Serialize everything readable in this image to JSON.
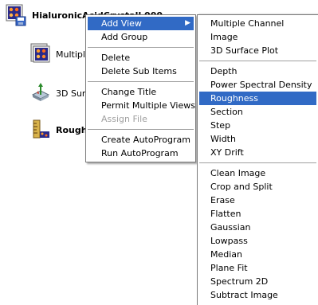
{
  "tree": {
    "root_label": "HialuronicAcidCrystall 000",
    "children": [
      {
        "label": "Multiple"
      },
      {
        "label": "3D Sur"
      },
      {
        "label": "Rough"
      }
    ]
  },
  "context_menu": {
    "items": [
      {
        "label": "Add View",
        "highlighted": true,
        "has_submenu": true
      },
      {
        "label": "Add Group"
      },
      {
        "label": "Delete"
      },
      {
        "label": "Delete Sub Items"
      },
      {
        "label": "Change Title"
      },
      {
        "label": "Permit Multiple Views"
      },
      {
        "label": "Assign File",
        "disabled": true
      },
      {
        "label": "Create AutoProgram"
      },
      {
        "label": "Run AutoProgram"
      }
    ]
  },
  "submenu": {
    "items": [
      {
        "label": "Multiple Channel"
      },
      {
        "label": "Image"
      },
      {
        "label": "3D Surface Plot"
      },
      {
        "label": "Depth"
      },
      {
        "label": "Power Spectral Density"
      },
      {
        "label": "Roughness",
        "highlighted": true
      },
      {
        "label": "Section"
      },
      {
        "label": "Step"
      },
      {
        "label": "Width"
      },
      {
        "label": "XY Drift"
      },
      {
        "label": "Clean Image"
      },
      {
        "label": "Crop and Split"
      },
      {
        "label": "Erase"
      },
      {
        "label": "Flatten"
      },
      {
        "label": "Gaussian"
      },
      {
        "label": "Lowpass"
      },
      {
        "label": "Median"
      },
      {
        "label": "Plane Fit"
      },
      {
        "label": "Spectrum 2D"
      },
      {
        "label": "Subtract Image"
      }
    ]
  },
  "colors": {
    "highlight": "#316ac5",
    "menu_border": "#7a7a7a",
    "disabled_text": "#a0a0a0"
  }
}
